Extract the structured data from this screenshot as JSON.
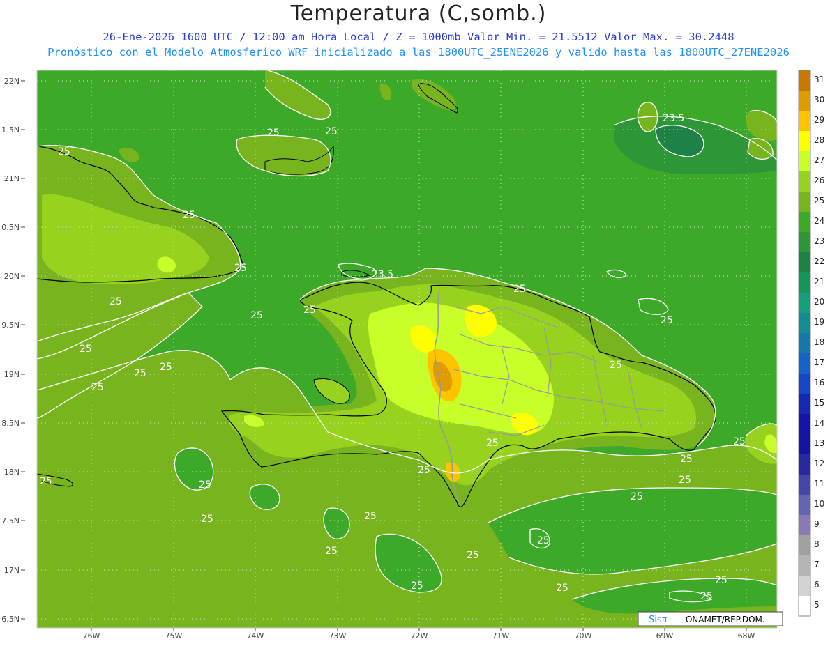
{
  "header": {
    "title": "Temperatura (C,somb.)",
    "subtitle": "26-Ene-2026 1600 UTC / 12:00 am Hora Local / Z = 1000mb  Valor Min. = 21.5512  Valor Max. = 30.2448",
    "subtitle2": "Pronóstico con el Modelo Atmosferico WRF inicializado a las 1800UTC_25ENE2026 y valido hasta las  1800UTC_27ENE2026"
  },
  "axes": {
    "lat_labels": [
      "22N",
      "1.5N",
      "21N",
      "0.5N",
      "20N",
      "9.5N",
      "19N",
      "8.5N",
      "18N",
      "7.5N",
      "17N",
      "6.5N"
    ],
    "lon_labels": [
      "76W",
      "75W",
      "74W",
      "73W",
      "72W",
      "71W",
      "70W",
      "69W",
      "68W"
    ]
  },
  "contour_labels": [
    "25",
    "25",
    "25",
    "25",
    "25",
    "25",
    "25",
    "25",
    "25",
    "25",
    "25",
    "25",
    "25",
    "25",
    "25",
    "25",
    "25",
    "25",
    "25",
    "25",
    "25",
    "25",
    "23.5",
    "23.5"
  ],
  "colorbar": {
    "levels": [
      "31",
      "30",
      "29",
      "28",
      "27",
      "26",
      "25",
      "24",
      "23",
      "22",
      "21",
      "20",
      "19",
      "18",
      "17",
      "16",
      "15",
      "14",
      "13",
      "12",
      "11",
      "10",
      "9",
      "8",
      "7",
      "6",
      "5"
    ],
    "colors": [
      "#c87800",
      "#e09b00",
      "#ffc400",
      "#ffff00",
      "#c8ff28",
      "#96d21e",
      "#78b41e",
      "#3caa28",
      "#2d9637",
      "#1e8246",
      "#14965a",
      "#14a07d",
      "#148c96",
      "#1478aa",
      "#1464c8",
      "#1446c8",
      "#1428b4",
      "#1414aa",
      "#1414a0",
      "#2828a0",
      "#4646aa",
      "#6464b4",
      "#8c78b4",
      "#a0a0a0",
      "#b4b4b4",
      "#d2d2d2",
      "#ffffff"
    ]
  },
  "credit": {
    "brand": "Sisπ",
    "text": "– ONAMET/REP.DOM."
  },
  "colors": {
    "sea": "#3caa28",
    "land_25": "#78b41e",
    "land_26": "#96d21e",
    "land_27": "#c8ff28",
    "land_28": "#ffff00",
    "land_29": "#ffc400",
    "land_30": "#e09b00",
    "cool_23": "#2d9637",
    "title_blue": "#2a3cdc",
    "sub_blue": "#1e90ff"
  }
}
